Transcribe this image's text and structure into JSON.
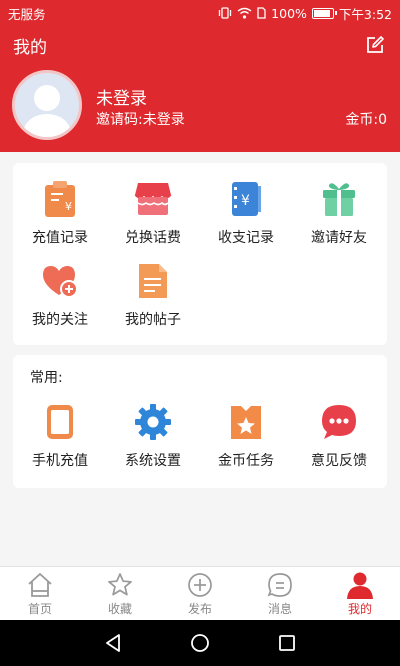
{
  "status_bar": {
    "carrier": "无服务",
    "battery": "100%",
    "time": "下午3:52"
  },
  "header": {
    "title": "我的"
  },
  "profile": {
    "name": "未登录",
    "invite_code": "邀请码:未登录",
    "coins": "金币:0"
  },
  "grid": {
    "items": [
      {
        "label": "充值记录",
        "icon": "recharge-record-icon"
      },
      {
        "label": "兑换话费",
        "icon": "store-icon"
      },
      {
        "label": "收支记录",
        "icon": "ledger-icon"
      },
      {
        "label": "邀请好友",
        "icon": "gift-icon"
      },
      {
        "label": "我的关注",
        "icon": "heart-plus-icon"
      },
      {
        "label": "我的帖子",
        "icon": "document-icon"
      }
    ]
  },
  "common": {
    "title": "常用:",
    "items": [
      {
        "label": "手机充值",
        "icon": "tablet-icon"
      },
      {
        "label": "系统设置",
        "icon": "gear-icon"
      },
      {
        "label": "金币任务",
        "icon": "task-star-icon"
      },
      {
        "label": "意见反馈",
        "icon": "chat-bubble-icon"
      }
    ]
  },
  "tabbar": {
    "items": [
      {
        "label": "首页",
        "icon": "home-icon",
        "active": false
      },
      {
        "label": "收藏",
        "icon": "star-icon",
        "active": false
      },
      {
        "label": "发布",
        "icon": "plus-circle-icon",
        "active": false
      },
      {
        "label": "消息",
        "icon": "message-icon",
        "active": false
      },
      {
        "label": "我的",
        "icon": "user-icon",
        "active": true
      }
    ]
  },
  "colors": {
    "brand_red": "#de2a2e",
    "inactive_gray": "#888888"
  }
}
